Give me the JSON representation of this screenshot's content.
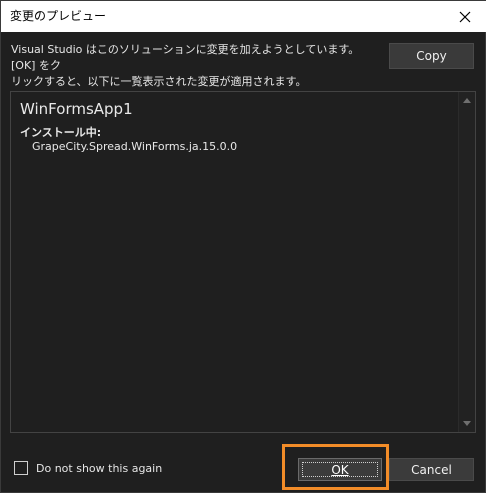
{
  "window": {
    "title": "変更のプレビュー"
  },
  "description": {
    "line1": "Visual Studio はこのソリューションに変更を加えようとしています。[OK] をク",
    "line2": "リックすると、以下に一覧表示された変更が適用されます。"
  },
  "buttons": {
    "copy_label": "Copy",
    "ok_label": "OK",
    "cancel_label": "Cancel"
  },
  "preview": {
    "project_name": "WinFormsApp1",
    "section_label": "インストール中:",
    "packages": [
      "GrapeCity.Spread.WinForms.ja.15.0.0"
    ]
  },
  "checkbox": {
    "label": "Do not show this again",
    "checked": false
  },
  "icons": {
    "close": "close-icon",
    "scroll_up": "chevron-up-icon",
    "scroll_down": "chevron-down-icon"
  },
  "colors": {
    "background": "#1f1f1f",
    "title_bar": "#ffffff",
    "button": "#3b3b3b",
    "highlight": "#f28c28"
  }
}
